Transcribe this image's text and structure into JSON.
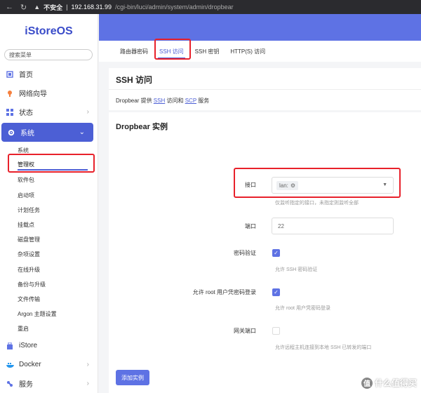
{
  "browser": {
    "security_label": "不安全",
    "host": "192.168.31.99",
    "path": "/cgi-bin/luci/admin/system/admin/dropbear"
  },
  "sidebar": {
    "logo": "iStoreOS",
    "search_placeholder": "搜索菜单",
    "items": [
      {
        "label": "首页",
        "icon": "home-icon"
      },
      {
        "label": "网络向导",
        "icon": "wizard-icon"
      },
      {
        "label": "状态",
        "icon": "grid-icon",
        "has_chevron": true
      }
    ],
    "system": {
      "label": "系统",
      "icon": "gear-icon",
      "sub_items": [
        "系统",
        "管理权",
        "软件包",
        "启动项",
        "计划任务",
        "挂载点",
        "磁盘管理",
        "杂项设置",
        "在线升级",
        "备份与升级",
        "文件传输",
        "Argon 主题设置",
        "重启"
      ]
    },
    "bottom_items": [
      {
        "label": "iStore",
        "icon": "store-icon",
        "has_chevron": false
      },
      {
        "label": "Docker",
        "icon": "docker-icon",
        "has_chevron": true
      },
      {
        "label": "服务",
        "icon": "services-icon",
        "has_chevron": true
      }
    ]
  },
  "tabs": [
    "路由器密码",
    "SSH 访问",
    "SSH 密钥",
    "HTTP(S) 访问"
  ],
  "active_tab": "SSH 访问",
  "section": {
    "title": "SSH 访问",
    "desc_prefix": "Dropbear 提供 ",
    "desc_ssh": "SSH",
    "desc_mid": " 访问和 ",
    "desc_scp": "SCP",
    "desc_suffix": " 服务"
  },
  "instance": {
    "title": "Dropbear 实例",
    "interface": {
      "label": "接口",
      "value": "lan:",
      "hint": "仅监听指定的接口，未指定则监听全部"
    },
    "port": {
      "label": "端口",
      "value": "22"
    },
    "password_auth": {
      "label": "密码验证",
      "checked": true,
      "hint": "允许 SSH 密码验证"
    },
    "root_password_login": {
      "label": "允许 root 用户凭密码登录",
      "checked": true,
      "hint": "允许 root 用户凭密码登录"
    },
    "gateway_ports": {
      "label": "网关端口",
      "checked": false,
      "hint": "允许远程主机连接到本地 SSH 已转发的端口"
    },
    "add_button": "添加实例"
  },
  "watermark": {
    "badge": "值",
    "text": "什么值得买"
  },
  "colors": {
    "accent": "#5e72e4",
    "highlight": "#e8212b"
  }
}
